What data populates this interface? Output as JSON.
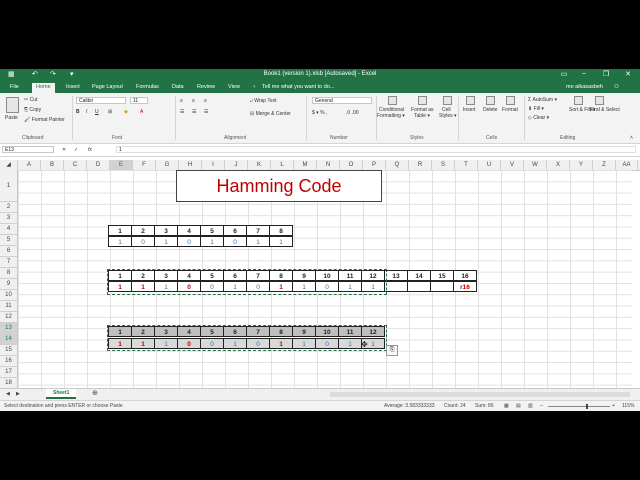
{
  "window": {
    "title": "Book1 (version 1).xlsb [Autosaved] - Excel",
    "user": "mo alkasasbeh"
  },
  "tabs": [
    "File",
    "Home",
    "Insert",
    "Page Layout",
    "Formulas",
    "Data",
    "Review",
    "View"
  ],
  "tell_me": "Tell me what you want to do...",
  "ribbon": {
    "paste": "Paste",
    "cut": "Cut",
    "copy": "Copy",
    "format_painter": "Format Painter",
    "clipboard": "Clipboard",
    "font_name": "Calibri",
    "font_size": "11",
    "font": "Font",
    "wrap_text": "Wrap Text",
    "merge_center": "Merge & Center",
    "alignment": "Alignment",
    "number_format": "General",
    "number": "Number",
    "conditional_formatting": "Conditional Formatting",
    "format_as_table": "Format as Table",
    "cell_styles": "Cell Styles",
    "styles": "Styles",
    "insert": "Insert",
    "delete": "Delete",
    "format": "Format",
    "cells": "Cells",
    "autosum": "AutoSum",
    "fill": "Fill",
    "clear": "Clear",
    "sort_filter": "Sort & Filter",
    "find_select": "Find & Select",
    "editing": "Editing"
  },
  "formula_bar": {
    "name_box": "E13",
    "fx": "fx",
    "value": "1"
  },
  "columns": [
    "A",
    "B",
    "C",
    "D",
    "E",
    "F",
    "G",
    "H",
    "I",
    "J",
    "K",
    "L",
    "M",
    "N",
    "O",
    "P",
    "Q",
    "R",
    "S",
    "T",
    "U",
    "V",
    "W",
    "X",
    "Y",
    "Z",
    "AA"
  ],
  "rows": [
    "1",
    "2",
    "3",
    "4",
    "5",
    "6",
    "7",
    "8",
    "9",
    "10",
    "11",
    "12",
    "13",
    "14",
    "15",
    "16",
    "17",
    "18"
  ],
  "heading": "Hamming Code",
  "table1": {
    "positions": [
      "1",
      "2",
      "3",
      "4",
      "5",
      "6",
      "7",
      "8"
    ],
    "bits": [
      "1",
      "0",
      "1",
      "0",
      "1",
      "0",
      "1",
      "1"
    ]
  },
  "table2": {
    "positions": [
      "1",
      "2",
      "3",
      "4",
      "5",
      "6",
      "7",
      "8",
      "9",
      "10",
      "11",
      "12",
      "13",
      "14",
      "15",
      "16"
    ],
    "bits": [
      "1",
      "1",
      "1",
      "0",
      "0",
      "1",
      "0",
      "1",
      "1",
      "0",
      "1",
      "1",
      "",
      "",
      "",
      "r16"
    ]
  },
  "table3": {
    "positions": [
      "1",
      "2",
      "3",
      "4",
      "5",
      "6",
      "7",
      "8",
      "9",
      "10",
      "11",
      "12"
    ],
    "bits": [
      "1",
      "1",
      "1",
      "0",
      "0",
      "1",
      "0",
      "1",
      "1",
      "0",
      "1",
      "1"
    ]
  },
  "sheet_tab": "Sheet1",
  "status": {
    "message": "Select destination and press ENTER or choose Paste",
    "average": "Average: 3.583333333",
    "count": "Count: 24",
    "sum": "Sum: 86",
    "zoom": "115%"
  },
  "colors": {
    "excel_green": "#217346",
    "blue_bits": "#2e75b6",
    "red_bits": "#c00000"
  }
}
